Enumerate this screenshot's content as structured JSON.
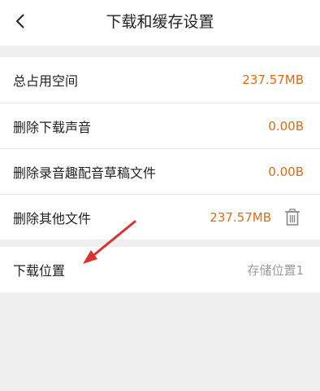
{
  "header": {
    "title": "下载和缓存设置"
  },
  "storage": [
    {
      "label": "总占用空间",
      "value": "237.57MB"
    },
    {
      "label": "删除下载声音",
      "value": "0.00B"
    },
    {
      "label": "删除录音趣配音草稿文件",
      "value": "0.00B"
    },
    {
      "label": "删除其他文件",
      "value": "237.57MB"
    }
  ],
  "location": {
    "label": "下载位置",
    "value": "存储位置1"
  },
  "colors": {
    "accent": "#e26a12",
    "annotation_arrow": "#d9342b"
  },
  "icons": {
    "back": "chevron-left-icon",
    "delete": "trash-icon"
  }
}
